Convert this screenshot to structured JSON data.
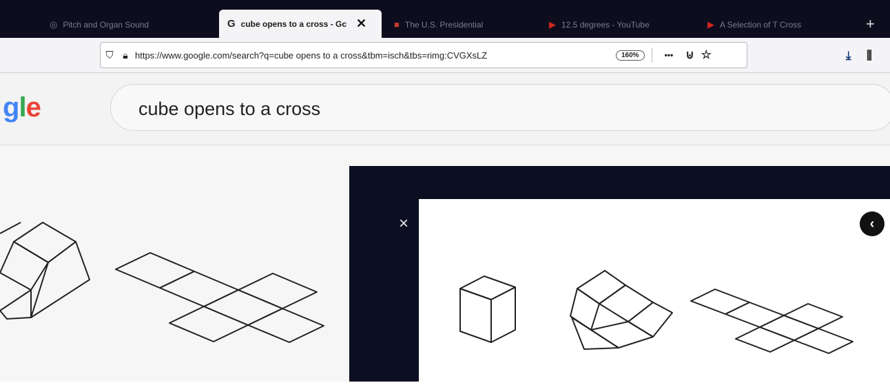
{
  "browser": {
    "tabs": [
      {
        "title": "Pitch and Organ Sound",
        "active": false
      },
      {
        "title": "cube opens to a cross - Gc",
        "active": true
      },
      {
        "title": "The U.S. Presidential",
        "active": false
      },
      {
        "title": "12.5 degrees - YouTube",
        "active": false
      },
      {
        "title": "A Selection of T Cross",
        "active": false
      }
    ],
    "new_tab_glyph": "+",
    "url": "https://www.google.com/search?q=cube opens to a cross&tbm=isch&tbs=rimg:CVGXsLZ",
    "zoom": "160%",
    "page_actions_glyph": "•••"
  },
  "google": {
    "logo_fragment": "gle",
    "logo_colors": [
      "#4285F4",
      "#34A853",
      "#EA4335"
    ],
    "search_query": "cube opens to a cross"
  },
  "preview": {
    "close_glyph": "×",
    "prev_glyph": "‹"
  },
  "icons": [
    "shield-icon",
    "lock-icon",
    "zoom-indicator",
    "more-icon",
    "pocket-icon",
    "bookmark-star-icon",
    "download-icon",
    "library-icon",
    "close-icon",
    "chevron-left-icon"
  ]
}
